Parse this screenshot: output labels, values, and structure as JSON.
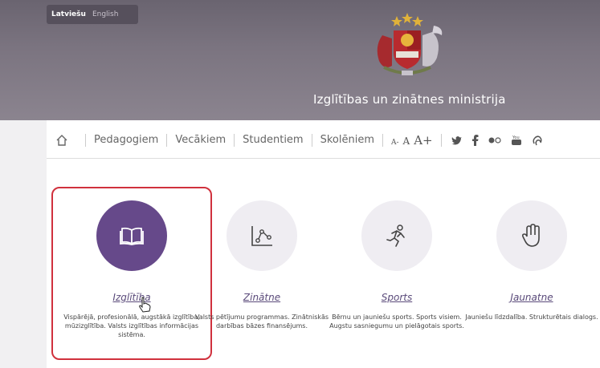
{
  "header": {
    "languages": [
      "Latviešu",
      "English"
    ],
    "site_title": "Izglītības un zinātnes ministrija"
  },
  "nav": {
    "items": [
      "Pedagogiem",
      "Vecākiem",
      "Studentiem",
      "Skolēniem"
    ],
    "font_sizes": [
      "A-",
      "A",
      "A+"
    ],
    "social_icons": [
      "twitter-icon",
      "facebook-icon",
      "flickr-icon",
      "youtube-icon",
      "draugiem-icon"
    ]
  },
  "cards": [
    {
      "title": "Izglītība",
      "desc": "Vispārējā, profesionālā, augstākā izglītība, mūzizglītība. Valsts izglītības informācijas sistēma.",
      "icon": "book-icon"
    },
    {
      "title": "Zinātne",
      "desc": "Valsts pētījumu programmas. Zinātniskās darbības bāzes finansējums.",
      "icon": "research-chart-icon"
    },
    {
      "title": "Sports",
      "desc": "Bērnu un jauniešu sports. Sports visiem. Augstu sasniegumu un pielāgotais sports.",
      "icon": "runner-icon"
    },
    {
      "title": "Jaunatne",
      "desc": "Jauniešu līdzdalība. Strukturētais dialogs.",
      "icon": "hand-icon"
    }
  ],
  "colors": {
    "accent": "#66498a",
    "highlight": "#d0313d"
  }
}
